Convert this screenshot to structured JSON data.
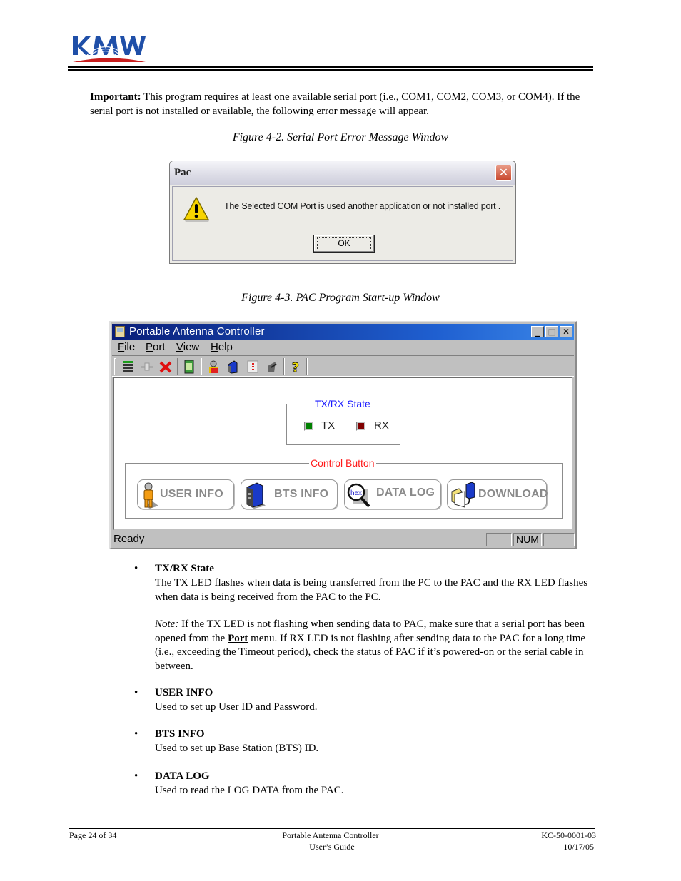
{
  "header": {
    "logo_text": "KMW",
    "logo_colors": {
      "blue": "#1f4fa8",
      "red": "#c81e1e"
    }
  },
  "intro": {
    "bold_label": "Important:",
    "text": " This program requires at least one available serial port (i.e., COM1, COM2, COM3, or COM4). If the serial port is not installed or available, the following error message will appear."
  },
  "figure_2": {
    "caption": "Figure 4-2. Serial Port Error Message Window",
    "dialog": {
      "title": "Pac",
      "close_glyph": "✕",
      "message": "The Selected COM Port is used another application or not installed port .",
      "ok_label": "OK",
      "icon": "warning-icon"
    }
  },
  "figure_3": {
    "caption": "Figure 4-3. PAC Program Start-up Window",
    "window": {
      "title": "Portable Antenna Controller",
      "controls": {
        "minimize": "_",
        "maximize": "□",
        "close": "✕"
      },
      "menu": [
        {
          "label": "File",
          "accel": "F",
          "rest": "ile"
        },
        {
          "label": "Port",
          "accel": "P",
          "rest": "ort"
        },
        {
          "label": "View",
          "accel": "V",
          "rest": "iew"
        },
        {
          "label": "Help",
          "accel": "H",
          "rest": "elp"
        }
      ],
      "toolbar_icons": [
        "port-list-icon",
        "connect-icon",
        "disconnect-icon",
        "data-file-icon",
        "user-info-icon",
        "bts-info-icon",
        "data-log-icon",
        "download-icon",
        "help-icon"
      ],
      "txrx_group": {
        "legend": "TX/RX State",
        "tx_label": "TX",
        "rx_label": "RX",
        "tx_color": "#008000",
        "rx_color": "#800000",
        "legend_color": "#1a1aff"
      },
      "control_group": {
        "legend": "Control Button",
        "legend_color": "#ff1a1a",
        "buttons": [
          {
            "label": "USER INFO",
            "icon": "user-icon"
          },
          {
            "label": "BTS INFO",
            "icon": "server-icon"
          },
          {
            "label": "DATA LOG",
            "icon": "hex-magnifier-icon",
            "icon_text": "hex"
          },
          {
            "label": "DOWNLOAD",
            "icon": "folder-download-icon"
          }
        ]
      },
      "status": {
        "text": "Ready",
        "panes": [
          "",
          "NUM",
          ""
        ]
      }
    }
  },
  "bullets": [
    {
      "title": "TX/RX State",
      "text": "The TX LED flashes when data is being transferred from the PC to the PAC and the RX LED flashes when data is being received from the PAC to the PC.",
      "note_label": "Note:",
      "note_text_1": " If the TX LED is not flashing when sending data to PAC, make sure that a serial port has been opened from the ",
      "note_bold": "Port",
      "note_text_2": " menu. If RX LED is not flashing after sending data to the PAC for a long time (i.e., exceeding the Timeout period), check the status of PAC if it’s powered-on or the serial cable in between."
    },
    {
      "title": "USER INFO",
      "text": "Used to set up User ID and Password."
    },
    {
      "title": "BTS INFO",
      "text": "Used to set up Base Station (BTS) ID."
    },
    {
      "title": "DATA LOG",
      "text": "Used to read the LOG DATA from the PAC."
    }
  ],
  "bullet_glyph": "•",
  "footer": {
    "page": "Page 24 of 34",
    "title_line1": "Portable Antenna Controller",
    "title_line2": "User’s Guide",
    "doc_id": "KC-50-0001-03",
    "date": "10/17/05"
  }
}
